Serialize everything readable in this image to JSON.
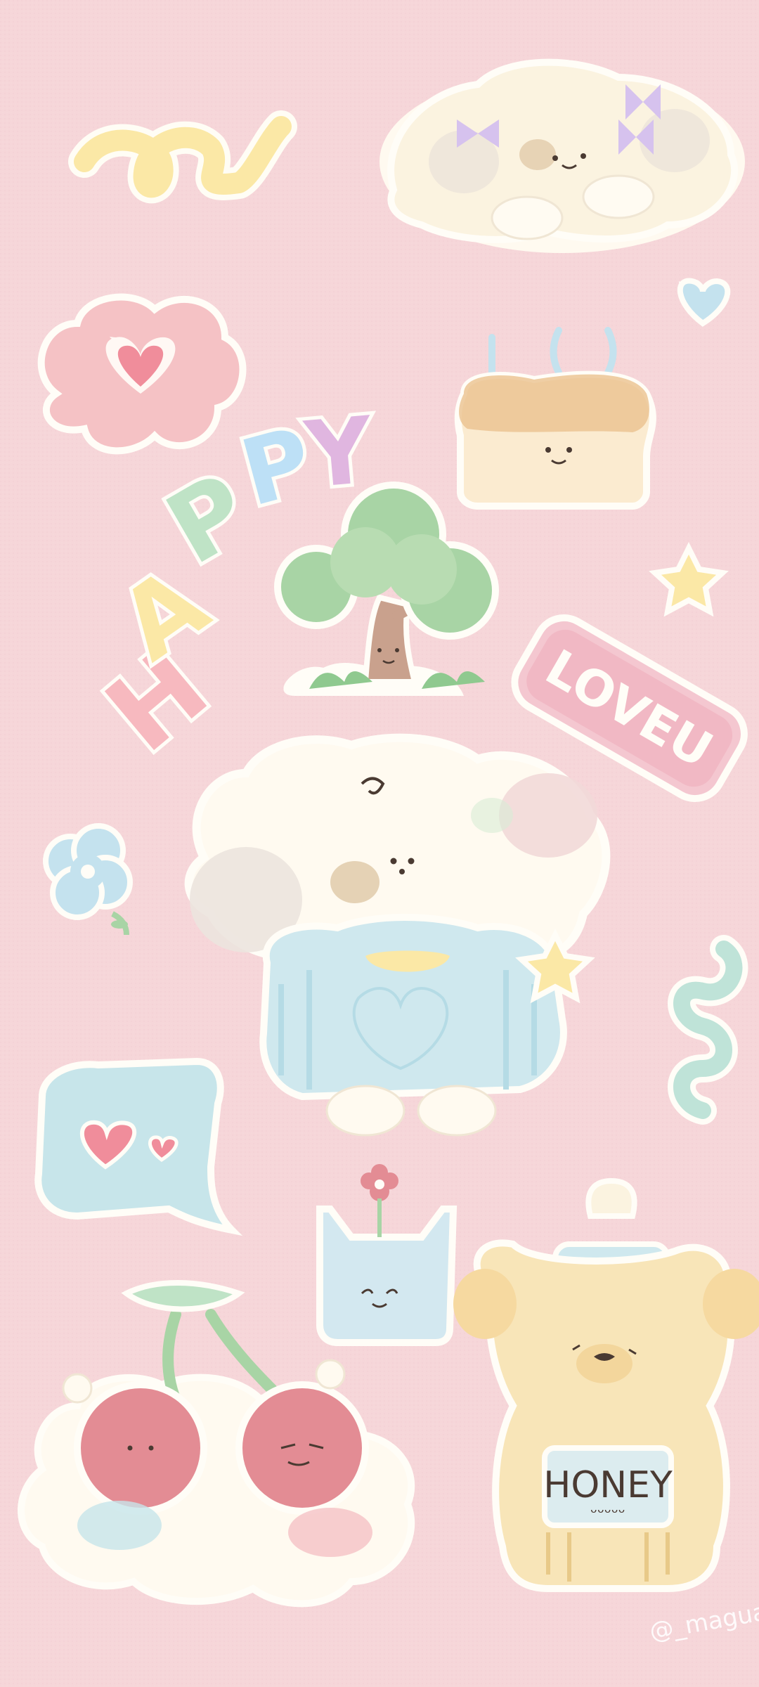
{
  "wallpaper": {
    "background_color": "#f6d6d9",
    "letters_happy": [
      "H",
      "A",
      "P",
      "P",
      "Y"
    ],
    "letter_colors": [
      "#f7b9bf",
      "#fbe8a6",
      "#bfe3c6",
      "#bde0f6",
      "#e0b6e0"
    ],
    "lovely_tag": "LOVEU",
    "honey_label": "HONEY",
    "honey_subtext": "ᵕᵕᵕᵕᵕ",
    "signature": "@_magua",
    "accent_colors": {
      "pink": "#f3a7b3",
      "cream": "#fbf5e6",
      "mint": "#c8e6cf",
      "sky": "#c4e2ee",
      "lilac": "#d5bde8",
      "honey": "#f6e1a8",
      "cherry": "#e38c94"
    }
  }
}
